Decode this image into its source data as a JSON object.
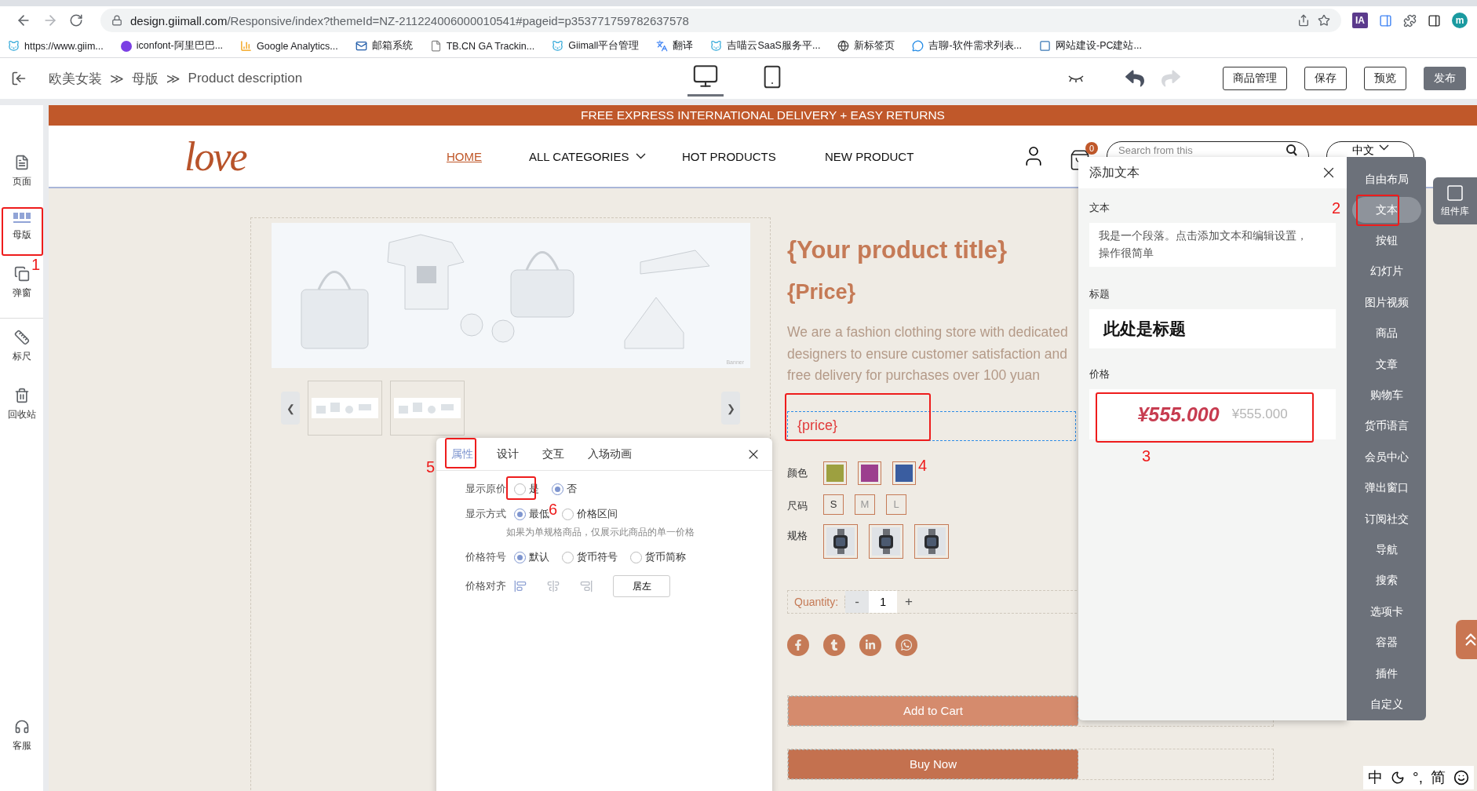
{
  "browser": {
    "url_host": "design.giimall.com",
    "url_path": "/Responsive/index?themeId=NZ-211224006000010541#pageid=p353771759782637578",
    "extension_badge": "IA",
    "profile_initial": "m"
  },
  "bookmarks": [
    {
      "label": "https://www.giim..."
    },
    {
      "label": "iconfont-阿里巴巴..."
    },
    {
      "label": "Google Analytics..."
    },
    {
      "label": "邮箱系统"
    },
    {
      "label": "TB.CN GA Trackin..."
    },
    {
      "label": "Giimall平台管理"
    },
    {
      "label": "翻译"
    },
    {
      "label": "吉喵云SaaS服务平..."
    },
    {
      "label": "新标签页"
    },
    {
      "label": "吉聊-软件需求列表..."
    },
    {
      "label": "网站建设-PC建站..."
    }
  ],
  "editor_toolbar": {
    "breadcrumb": [
      "欧美女装",
      "母版",
      "Product description"
    ],
    "separator": "≫",
    "devices": [
      {
        "kind": "desktop",
        "selected": true
      },
      {
        "kind": "mobile",
        "selected": false
      }
    ],
    "history": [
      {
        "kind": "undo",
        "disabled": false
      },
      {
        "kind": "redo",
        "disabled": true
      }
    ],
    "buttons": [
      {
        "label": "商品管理",
        "kind": "outline"
      },
      {
        "label": "保存",
        "kind": "outline"
      },
      {
        "label": "预览",
        "kind": "outline"
      },
      {
        "label": "发布",
        "kind": "primary"
      }
    ]
  },
  "sidebar": {
    "items": [
      {
        "label": "页面",
        "selected": false
      },
      {
        "label": "母版",
        "selected": true
      },
      {
        "label": "弹窗",
        "selected": false
      },
      {
        "label": "标尺",
        "selected": false
      },
      {
        "label": "回收站",
        "selected": false
      }
    ],
    "support": {
      "label": "客服"
    }
  },
  "store": {
    "banner": "FREE EXPRESS INTERNATIONAL DELIVERY + EASY RETURNS",
    "logo": "love",
    "nav": [
      {
        "label": "HOME",
        "selected": true,
        "dropdown": false
      },
      {
        "label": "ALL CATEGORIES",
        "selected": false,
        "dropdown": true
      },
      {
        "label": "HOT PRODUCTS",
        "selected": false,
        "dropdown": false
      },
      {
        "label": "NEW PRODUCT",
        "selected": false,
        "dropdown": false
      }
    ],
    "cart_count": "0",
    "search_placeholder": "Search from this",
    "language": "中文"
  },
  "product": {
    "gallery": {
      "caption": "Banner",
      "prev": "❮",
      "next": "❯"
    },
    "title": "{Your product title}",
    "price": "{Price}",
    "description": "We are a fashion clothing store with dedicated designers to ensure customer satisfaction and free delivery for purchases over 100 yuan",
    "price_field": "{price}",
    "options": [
      {
        "label": "颜色",
        "kind": "color",
        "values": [
          {
            "color": "#9da040"
          },
          {
            "color": "#9c3f8e"
          },
          {
            "color": "#3a5da0"
          }
        ]
      },
      {
        "label": "尺码",
        "kind": "size",
        "values": [
          {
            "text": "S",
            "selected": true
          },
          {
            "text": "M",
            "selected": false
          },
          {
            "text": "L",
            "selected": false
          }
        ]
      },
      {
        "label": "规格"
      }
    ],
    "quantity": {
      "label": "Quantity:",
      "minus": "-",
      "value": "1",
      "plus": "+"
    },
    "social": [
      {
        "kind": "facebook"
      },
      {
        "kind": "tumblr"
      },
      {
        "kind": "linkedin"
      },
      {
        "kind": "whatsapp"
      }
    ],
    "buttons": [
      {
        "label": "Add to Cart",
        "kind": "light"
      },
      {
        "label": "Buy Now",
        "kind": "dark"
      }
    ]
  },
  "add_text_panel": {
    "title": "添加文本",
    "sections": [
      {
        "label": "文本",
        "kind": "paragraph",
        "text": "我是一个段落。点击添加文本和编辑设置，操作很简单"
      },
      {
        "label": "标题",
        "kind": "heading",
        "text": "此处是标题"
      },
      {
        "label": "价格",
        "kind": "price",
        "price": "¥555.000",
        "original_price": "¥555.000"
      }
    ]
  },
  "components": {
    "items": [
      {
        "label": "自由布局",
        "selected": false
      },
      {
        "label": "文本",
        "selected": true
      },
      {
        "label": "按钮",
        "selected": false
      },
      {
        "label": "幻灯片",
        "selected": false
      },
      {
        "label": "图片视频",
        "selected": false
      },
      {
        "label": "商品",
        "selected": false
      },
      {
        "label": "文章",
        "selected": false
      },
      {
        "label": "购物车",
        "selected": false
      },
      {
        "label": "货币语言",
        "selected": false
      },
      {
        "label": "会员中心",
        "selected": false
      },
      {
        "label": "弹出窗口",
        "selected": false
      },
      {
        "label": "订阅社交",
        "selected": false
      },
      {
        "label": "导航",
        "selected": false
      },
      {
        "label": "搜索",
        "selected": false
      },
      {
        "label": "选项卡",
        "selected": false
      },
      {
        "label": "容器",
        "selected": false
      },
      {
        "label": "插件",
        "selected": false
      },
      {
        "label": "自定义",
        "selected": false
      }
    ],
    "library": {
      "label": "组件库"
    }
  },
  "property_popup": {
    "tabs": [
      {
        "label": "属性",
        "selected": true
      },
      {
        "label": "设计",
        "selected": false
      },
      {
        "label": "交互",
        "selected": false
      },
      {
        "label": "入场动画",
        "selected": false
      }
    ],
    "rows": [
      {
        "label": "显示原价",
        "kind": "radio",
        "options": [
          {
            "label": "是",
            "selected": false
          },
          {
            "label": "否",
            "selected": true
          }
        ]
      },
      {
        "label": "显示方式",
        "kind": "radio",
        "options": [
          {
            "label": "最低",
            "selected": true
          },
          {
            "label": "价格区间",
            "selected": false
          }
        ],
        "hint": "如果为单规格商品，仅展示此商品的单一价格"
      },
      {
        "label": "价格符号",
        "kind": "radio",
        "options": [
          {
            "label": "默认",
            "selected": true
          },
          {
            "label": "货币符号",
            "selected": false
          },
          {
            "label": "货币简称",
            "selected": false
          }
        ]
      },
      {
        "label": "价格对齐",
        "kind": "align",
        "options": [
          {
            "kind": "left",
            "selected": true
          },
          {
            "kind": "center",
            "selected": false
          },
          {
            "kind": "right",
            "selected": false
          }
        ],
        "button": "居左"
      }
    ]
  },
  "annotations": [
    "1",
    "2",
    "3",
    "4",
    "5",
    "6"
  ],
  "ime": [
    {
      "kind": "text",
      "text": "中"
    },
    {
      "kind": "moon"
    },
    {
      "kind": "text",
      "text": "°,"
    },
    {
      "kind": "text",
      "text": "简"
    },
    {
      "kind": "smile"
    }
  ]
}
